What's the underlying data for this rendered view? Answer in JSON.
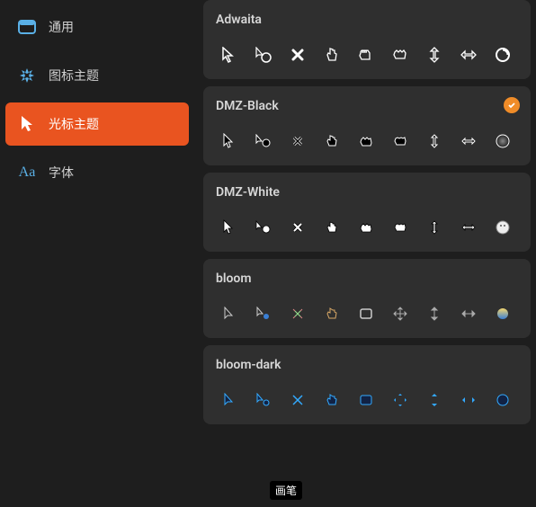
{
  "sidebar": {
    "items": [
      {
        "label": "通用",
        "icon": "general-icon"
      },
      {
        "label": "图标主题",
        "icon": "icon-theme-icon"
      },
      {
        "label": "光标主题",
        "icon": "cursor-theme-icon"
      },
      {
        "label": "字体",
        "icon": "font-icon"
      }
    ],
    "active_index": 2
  },
  "themes": [
    {
      "name": "Adwaita",
      "selected": false,
      "style": "outline-white"
    },
    {
      "name": "DMZ-Black",
      "selected": true,
      "style": "outline-white"
    },
    {
      "name": "DMZ-White",
      "selected": false,
      "style": "solid-white"
    },
    {
      "name": "bloom",
      "selected": false,
      "style": "thin"
    },
    {
      "name": "bloom-dark",
      "selected": false,
      "style": "blue-outline"
    }
  ],
  "cursor_glyphs": [
    "arrow",
    "busy",
    "cross",
    "hand",
    "grab",
    "grabbing",
    "resize-v",
    "resize-h",
    "wait"
  ],
  "tooltip": "画笔",
  "colors": {
    "accent": "#e95420",
    "selected_badge": "#f08c28",
    "card_bg": "#2f2f2f",
    "page_bg": "#1e1e1e"
  }
}
